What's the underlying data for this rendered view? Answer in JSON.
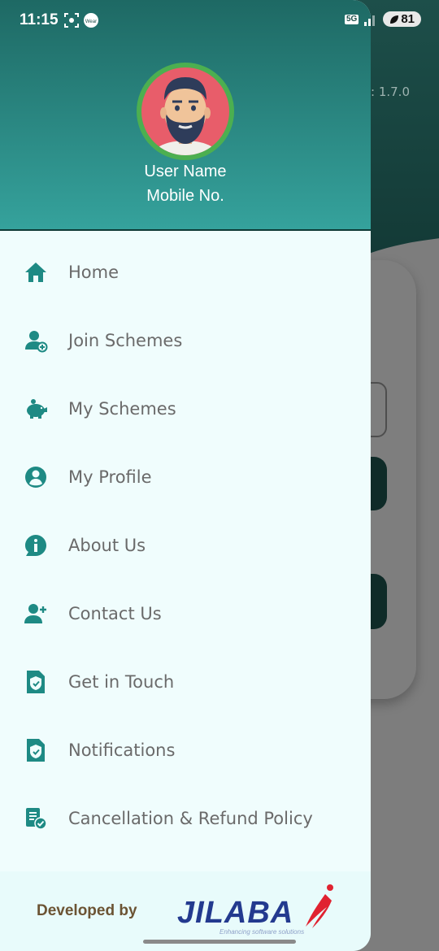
{
  "status_bar": {
    "time": "11:15",
    "network": "5G",
    "battery": "81"
  },
  "background": {
    "version": ": 1.7.0"
  },
  "drawer": {
    "user_name": "User Name",
    "mobile": "Mobile No.",
    "menu": [
      {
        "label": "Home",
        "icon": "home-icon"
      },
      {
        "label": "Join Schemes",
        "icon": "user-add-icon"
      },
      {
        "label": "My Schemes",
        "icon": "piggy-bank-icon"
      },
      {
        "label": "My Profile",
        "icon": "profile-icon"
      },
      {
        "label": "About Us",
        "icon": "info-icon"
      },
      {
        "label": "Contact Us",
        "icon": "contact-icon"
      },
      {
        "label": "Get in Touch",
        "icon": "shield-doc-icon"
      },
      {
        "label": "Notifications",
        "icon": "shield-doc-icon"
      },
      {
        "label": "Cancellation & Refund Policy",
        "icon": "policy-doc-icon"
      }
    ],
    "footer": {
      "developed_by": "Developed by",
      "logo_text": "JILABA",
      "logo_tagline": "Enhancing software solutions"
    }
  },
  "colors": {
    "accent": "#1e8a84",
    "header_top": "#1e6964",
    "header_bottom": "#35a29c",
    "label": "#6a6a6a"
  }
}
